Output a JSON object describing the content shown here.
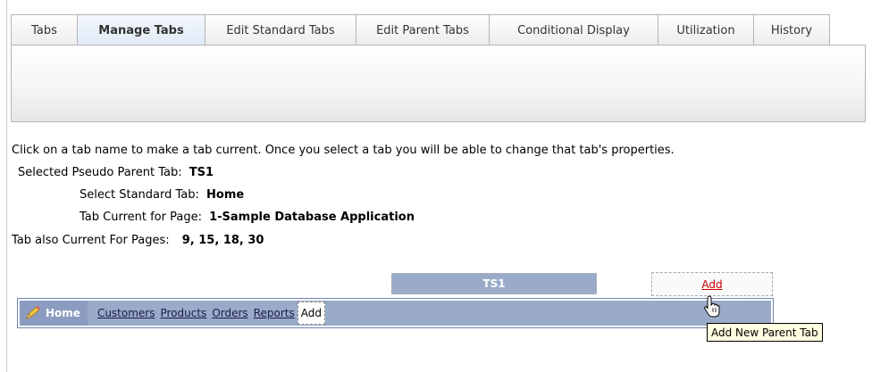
{
  "tabs": [
    {
      "label": "Tabs",
      "active": false
    },
    {
      "label": "Manage Tabs",
      "active": true
    },
    {
      "label": "Edit Standard Tabs",
      "active": false
    },
    {
      "label": "Edit Parent Tabs",
      "active": false
    },
    {
      "label": "Conditional Display",
      "active": false
    },
    {
      "label": "Utilization",
      "active": false
    },
    {
      "label": "History",
      "active": false
    }
  ],
  "info": {
    "instruction": "Click on a tab name to make a tab current. Once you select a tab you will be able to change that tab's properties.",
    "selected_parent_label": "Selected Pseudo Parent Tab:",
    "selected_parent_value": "TS1",
    "select_standard_label": "Select Standard Tab:",
    "select_standard_value": "Home",
    "tab_current_label": "Tab Current for Page:",
    "tab_current_value": "1-Sample Database Application",
    "also_current_label": "Tab also Current For Pages:",
    "also_current_value": "9, 15, 18, 30"
  },
  "parent_tabs": {
    "ts1_label": "TS1",
    "add_label": "Add"
  },
  "standard_tabs": {
    "home_label": "Home",
    "items": [
      "Customers",
      "Products",
      "Orders",
      "Reports"
    ],
    "add_label": "Add"
  },
  "tooltip": "Add New Parent Tab",
  "colors": {
    "tab_strip": "#9aabc9",
    "add_link": "#cc0000",
    "tooltip_bg": "#ffffe1"
  }
}
